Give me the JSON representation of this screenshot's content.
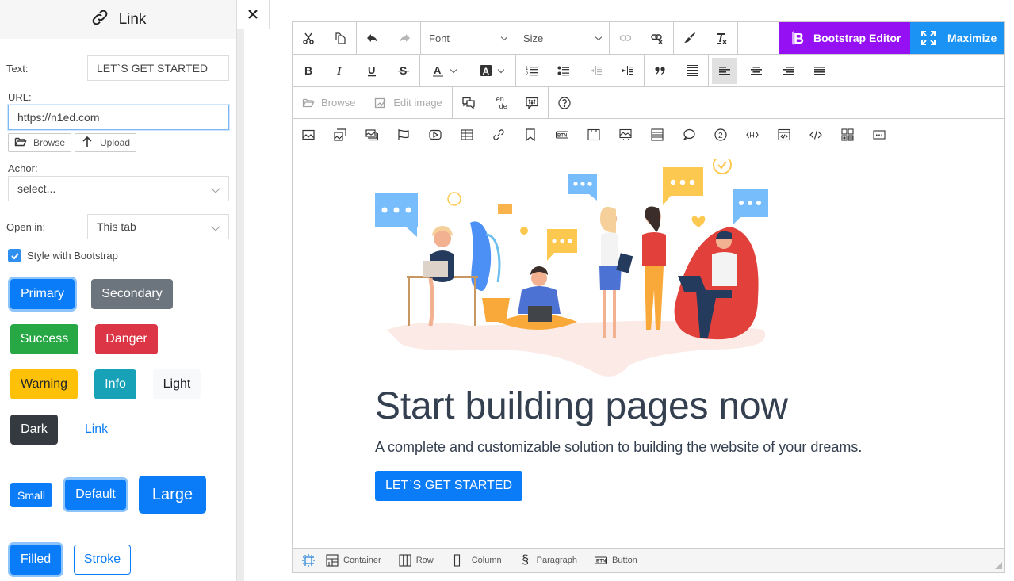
{
  "panel": {
    "title": "Link",
    "text_label": "Text:",
    "text_value": "LET`S GET STARTED",
    "url_label": "URL:",
    "url_value": "https://n1ed.com",
    "browse_label": "Browse",
    "upload_label": "Upload",
    "anchor_label": "Achor:",
    "anchor_value": "select...",
    "openin_label": "Open in:",
    "openin_value": "This tab",
    "bootstrap_label": "Style with Bootstrap",
    "bootstrap_checked": true,
    "styles": [
      {
        "label": "Primary",
        "bg": "#0a7cf7",
        "fg": "#ffffff",
        "selected": true
      },
      {
        "label": "Secondary",
        "bg": "#6c757d",
        "fg": "#ffffff",
        "selected": false
      },
      {
        "label": "Success",
        "bg": "#28a745",
        "fg": "#ffffff",
        "selected": false
      },
      {
        "label": "Danger",
        "bg": "#dc3545",
        "fg": "#ffffff",
        "selected": false
      },
      {
        "label": "Warning",
        "bg": "#ffc107",
        "fg": "#212529",
        "selected": false
      },
      {
        "label": "Info",
        "bg": "#17a2b8",
        "fg": "#ffffff",
        "selected": false
      },
      {
        "label": "Light",
        "bg": "#f8f9fa",
        "fg": "#212529",
        "selected": false
      },
      {
        "label": "Dark",
        "bg": "#343a40",
        "fg": "#ffffff",
        "selected": false
      },
      {
        "label": "Link",
        "bg": "transparent",
        "fg": "#0a7cf7",
        "selected": false
      }
    ],
    "sizes": [
      {
        "label": "Small",
        "selected": false
      },
      {
        "label": "Default",
        "selected": true
      },
      {
        "label": "Large",
        "selected": false
      }
    ],
    "fills": [
      {
        "label": "Filled",
        "selected": true
      },
      {
        "label": "Stroke",
        "selected": false
      }
    ]
  },
  "close_icon": "close-icon",
  "toolbar": {
    "font_label": "Font",
    "size_label": "Size",
    "bootstrap_editor_label": "Bootstrap Editor",
    "maximize_label": "Maximize",
    "browse_label": "Browse",
    "edit_image_label": "Edit image",
    "lang_top": "en",
    "lang_bottom": "de"
  },
  "content": {
    "heading": "Start building pages now",
    "lead": "A complete and customizable solution to building the website of your dreams.",
    "cta": "LET`S GET STARTED"
  },
  "statusbar": {
    "items": [
      "Container",
      "Row",
      "Column",
      "Paragraph",
      "Button"
    ]
  },
  "colors": {
    "accent": "#0a7cf7",
    "bootstrap_editor": "#9510f3",
    "maximize": "#1b93f4"
  }
}
